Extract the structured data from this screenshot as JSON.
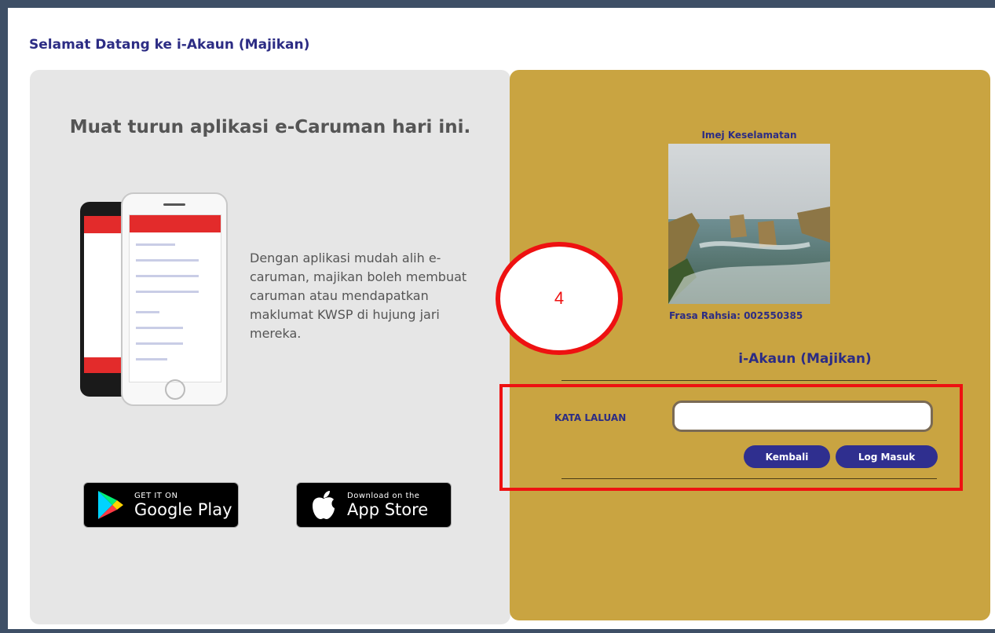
{
  "page": {
    "title": "Selamat Datang ke i-Akaun (Majikan)"
  },
  "promo": {
    "heading": "Muat turun aplikasi e-Caruman hari ini.",
    "description": "Dengan aplikasi mudah alih e-caruman, majikan boleh membuat caruman atau mendapatkan maklumat KWSP di hujung jari mereka.",
    "google_play": {
      "small": "GET IT ON",
      "big": "Google Play"
    },
    "app_store": {
      "small": "Download on the",
      "big": "App Store"
    }
  },
  "login": {
    "security_image_label": "Imej Keselamatan",
    "secret_phrase": "Frasa Rahsia: 002550385",
    "account_title": "i-Akaun (Majikan)",
    "password_label": "KATA LALUAN",
    "password_value": "",
    "back_button": "Kembali",
    "login_button": "Log Masuk"
  },
  "annotation": {
    "step_number": "4",
    "color": "#ee1111"
  },
  "colors": {
    "gold_panel": "#c9a441",
    "grey_panel": "#e6e6e6",
    "navy_text": "#2c2c84",
    "button": "#2f2f8f"
  }
}
